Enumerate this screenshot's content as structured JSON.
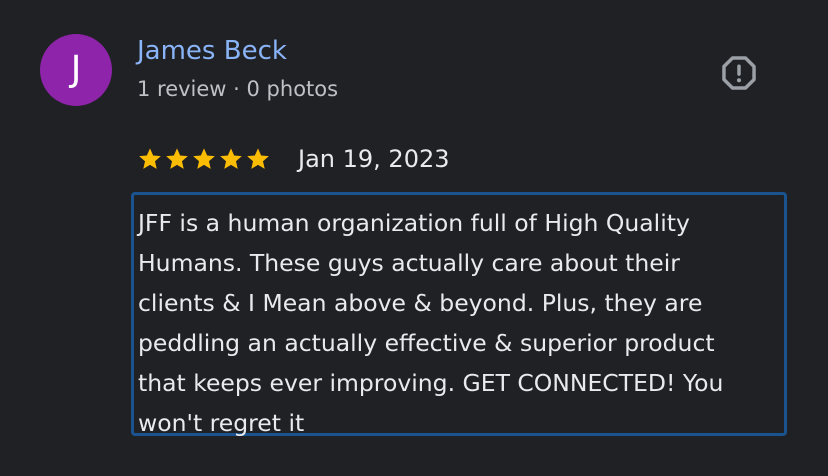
{
  "review": {
    "author": {
      "initial": "J",
      "name": "James Beck",
      "meta": "1 review · 0 photos",
      "avatar_color": "#8e24aa",
      "name_color": "#8ab4f8"
    },
    "report_icon": "report-octagon-icon",
    "rating": {
      "stars": 5,
      "max": 5,
      "star_icon": "star-icon",
      "star_color": "#fbbc04"
    },
    "date": "Jan 19, 2023",
    "text": "JFF is a human organization full of High Quality\nHumans. These guys actually care about their\nclients & I Mean above & beyond. Plus, they are\npeddling an actually effective & superior product\nthat keeps ever improving. GET CONNECTED! You\nwon't regret it",
    "highlight_color": "#1a5490"
  }
}
